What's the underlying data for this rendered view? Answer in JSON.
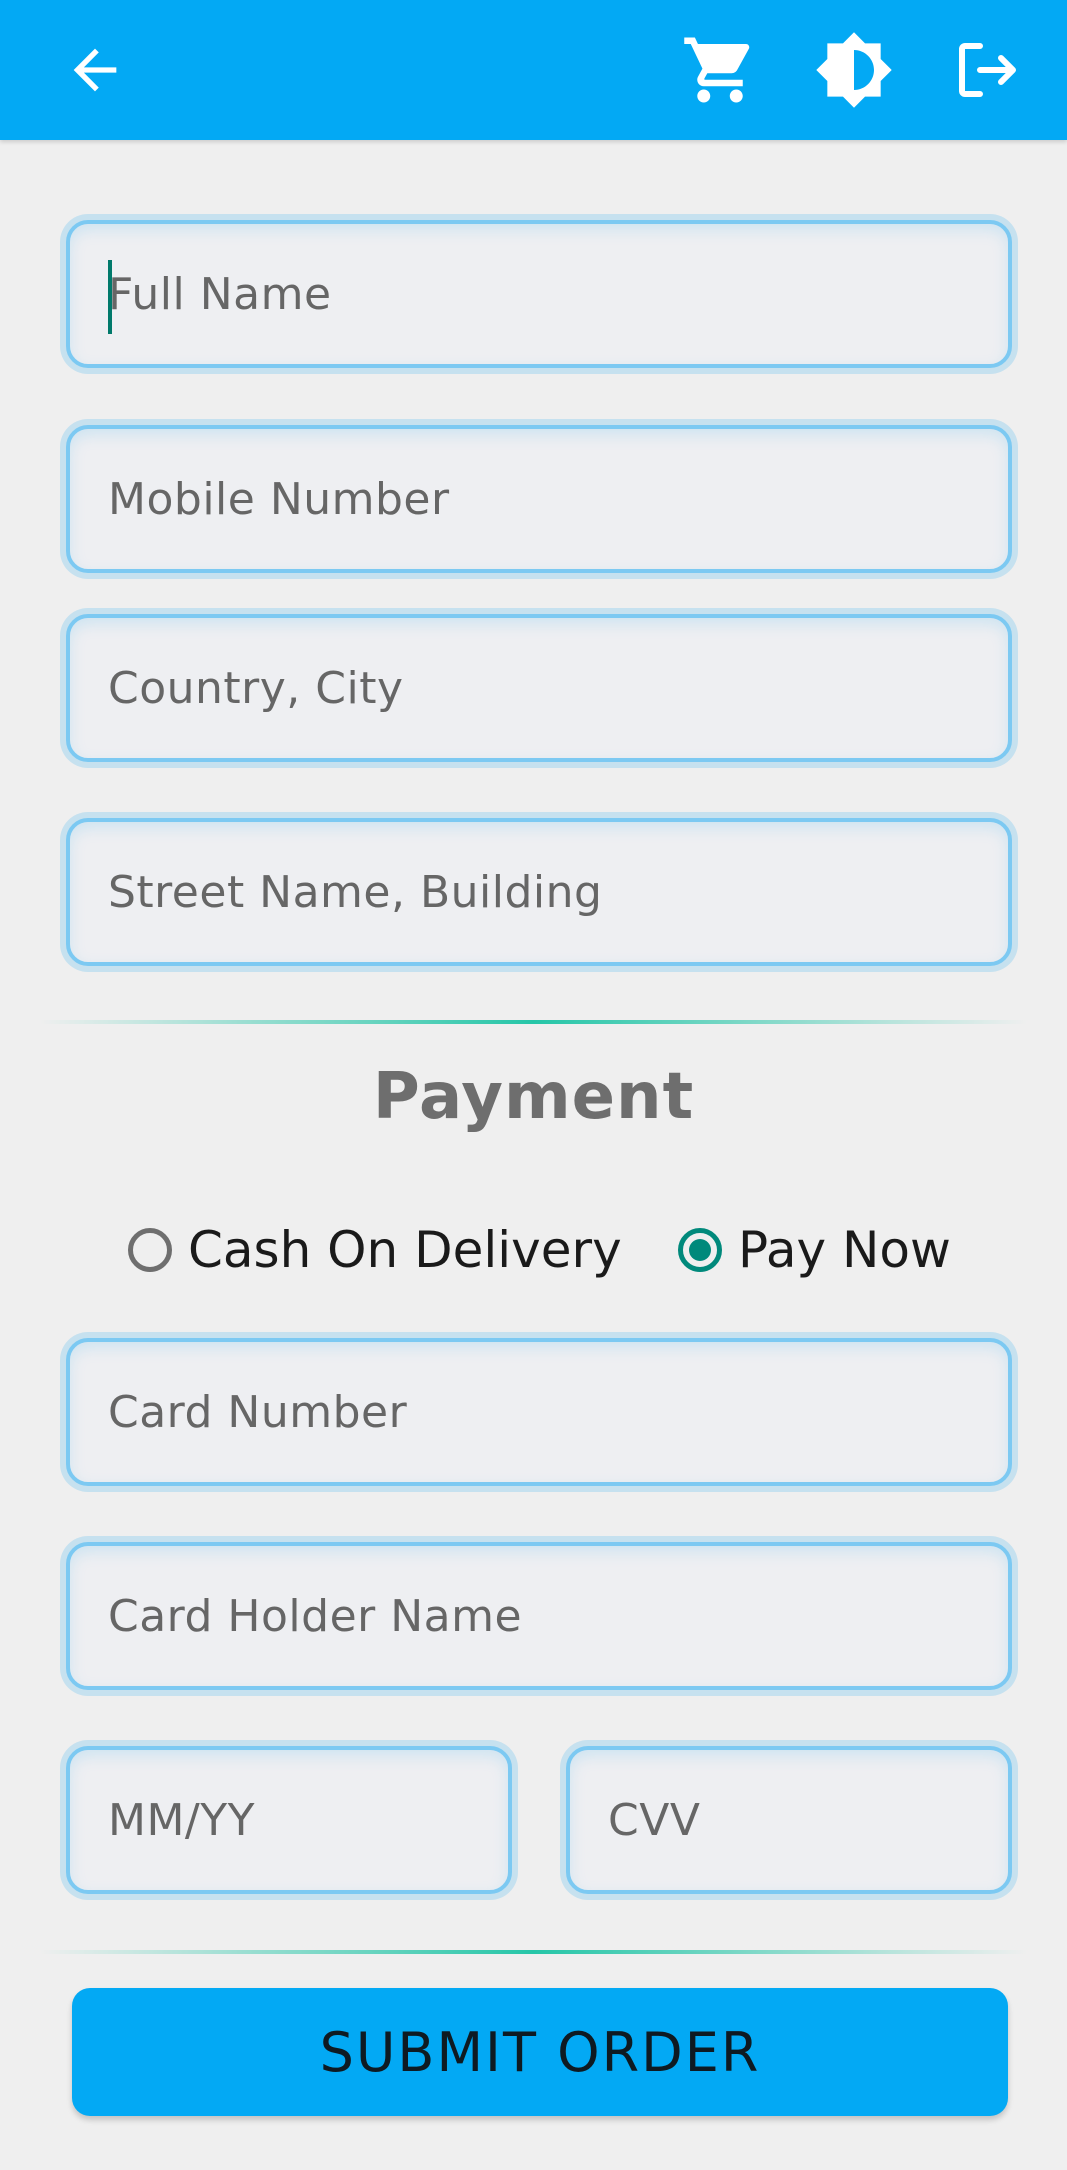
{
  "appbar": {
    "icons": [
      "back-arrow-icon",
      "cart-icon",
      "brightness-icon",
      "logout-icon"
    ],
    "color": "#03a9f4"
  },
  "form": {
    "full_name_placeholder": "Full Name",
    "mobile_placeholder": "Mobile Number",
    "country_city_placeholder": "Country, City",
    "street_placeholder": "Street Name, Building"
  },
  "payment": {
    "title": "Payment",
    "options": [
      {
        "label": "Cash On Delivery",
        "selected": false
      },
      {
        "label": "Pay Now",
        "selected": true
      }
    ],
    "card_number_placeholder": "Card Number",
    "card_holder_placeholder": "Card Holder Name",
    "expiry_placeholder": "MM/YY",
    "cvv_placeholder": "CVV"
  },
  "submit_label": "SUBMIT ORDER",
  "colors": {
    "accent": "#03a9f4",
    "radio_selected": "#00897b",
    "field_border": "#7cc9f2",
    "divider": "#26c6a8"
  }
}
